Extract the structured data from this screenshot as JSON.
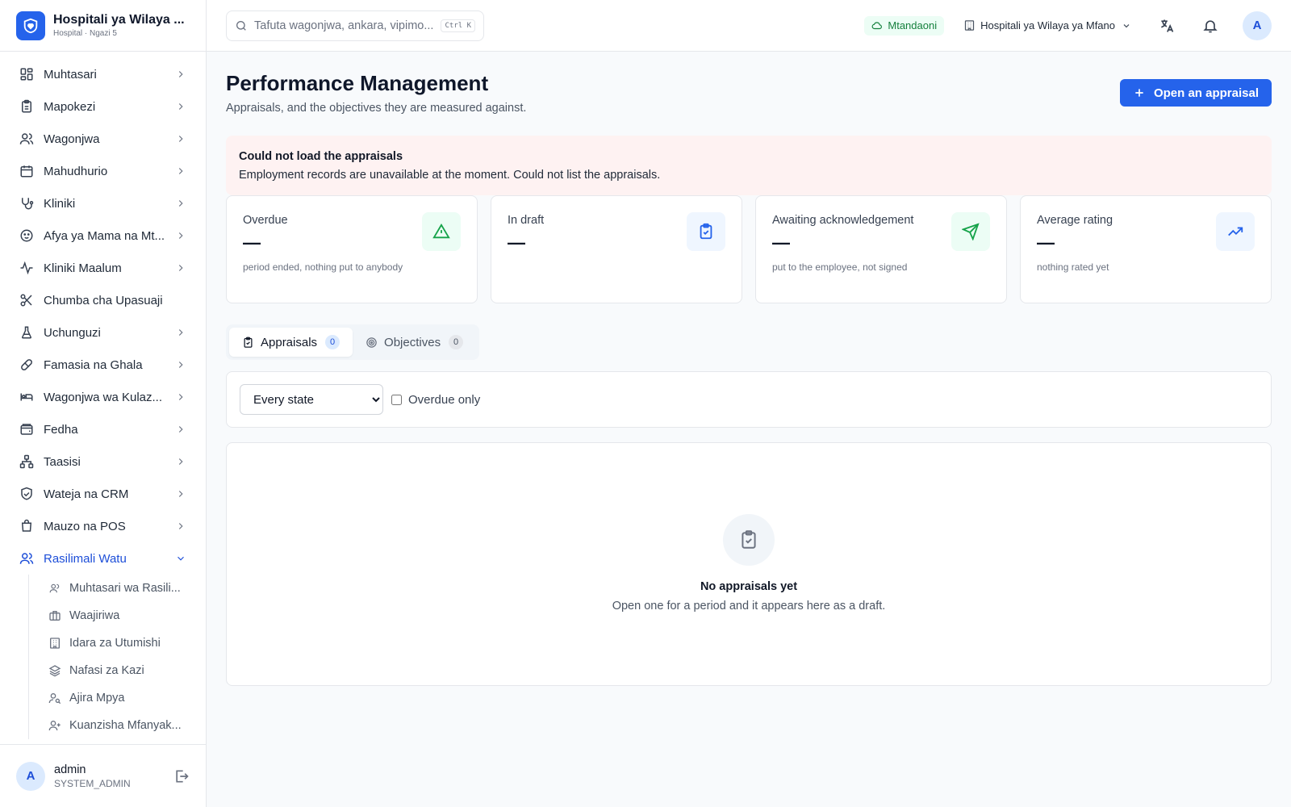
{
  "brand": {
    "title": "Hospitali ya Wilaya ...",
    "subtitle": "Hospital · Ngazi 5",
    "icon": "heart-shield-icon"
  },
  "sidebar": {
    "items": [
      {
        "label": "Muhtasari",
        "icon": "dashboard-icon"
      },
      {
        "label": "Mapokezi",
        "icon": "clipboard-icon"
      },
      {
        "label": "Wagonjwa",
        "icon": "users-icon"
      },
      {
        "label": "Mahudhurio",
        "icon": "calendar-icon"
      },
      {
        "label": "Kliniki",
        "icon": "stethoscope-icon"
      },
      {
        "label": "Afya ya Mama na Mt...",
        "icon": "baby-icon"
      },
      {
        "label": "Kliniki Maalum",
        "icon": "activity-icon"
      },
      {
        "label": "Chumba cha Upasuaji",
        "icon": "scissors-icon"
      },
      {
        "label": "Uchunguzi",
        "icon": "flask-icon"
      },
      {
        "label": "Famasia na Ghala",
        "icon": "pill-icon"
      },
      {
        "label": "Wagonjwa wa Kulaz...",
        "icon": "bed-icon"
      },
      {
        "label": "Fedha",
        "icon": "wallet-icon"
      },
      {
        "label": "Taasisi",
        "icon": "network-icon"
      },
      {
        "label": "Wateja na CRM",
        "icon": "handshake-icon"
      },
      {
        "label": "Mauzo na POS",
        "icon": "shopping-bag-icon"
      },
      {
        "label": "Rasilimali Watu",
        "icon": "users-icon"
      }
    ],
    "sub_items": [
      {
        "label": "Muhtasari wa Rasili...",
        "icon": "users-small-icon"
      },
      {
        "label": "Waajiriwa",
        "icon": "briefcase-icon"
      },
      {
        "label": "Idara za Utumishi",
        "icon": "building-icon"
      },
      {
        "label": "Nafasi za Kazi",
        "icon": "layers-icon"
      },
      {
        "label": "Ajira Mpya",
        "icon": "user-search-icon"
      },
      {
        "label": "Kuanzisha Mfanyak...",
        "icon": "user-plus-icon"
      }
    ]
  },
  "user": {
    "avatar": "A",
    "name": "admin",
    "role": "SYSTEM_ADMIN"
  },
  "topbar": {
    "search_placeholder": "Tafuta wagonjwa, ankara, vipimo...",
    "shortcut": "Ctrl K",
    "status": "Mtandaoni",
    "facility": "Hospitali ya Wilaya ya Mfano",
    "avatar": "A"
  },
  "page": {
    "title": "Performance Management",
    "subtitle": "Appraisals, and the objectives they are measured against.",
    "primary_button": "Open an appraisal"
  },
  "error": {
    "title": "Could not load the appraisals",
    "message": "Employment records are unavailable at the moment. Could not list the appraisals."
  },
  "stats": [
    {
      "label": "Overdue",
      "value": "—",
      "note": "period ended, nothing put to anybody",
      "icon": "alert-triangle-icon",
      "color": "#16a34a",
      "bg": "#ecfdf5"
    },
    {
      "label": "In draft",
      "value": "—",
      "note": "",
      "icon": "clipboard-check-icon",
      "color": "#2563eb",
      "bg": "#eff6ff"
    },
    {
      "label": "Awaiting acknowledgement",
      "value": "—",
      "note": "put to the employee, not signed",
      "icon": "send-icon",
      "color": "#16a34a",
      "bg": "#ecfdf5"
    },
    {
      "label": "Average rating",
      "value": "—",
      "note": "nothing rated yet",
      "icon": "trending-up-icon",
      "color": "#2563eb",
      "bg": "#eff6ff"
    }
  ],
  "tabs": [
    {
      "label": "Appraisals",
      "count": "0"
    },
    {
      "label": "Objectives",
      "count": "0"
    }
  ],
  "filters": {
    "state_selected": "Every state",
    "overdue_label": "Overdue only"
  },
  "empty": {
    "title": "No appraisals yet",
    "message": "Open one for a period and it appears here as a draft."
  },
  "colors": {
    "accent": "#2563eb",
    "error_bg": "#fef2f2",
    "online": "#15803d"
  }
}
